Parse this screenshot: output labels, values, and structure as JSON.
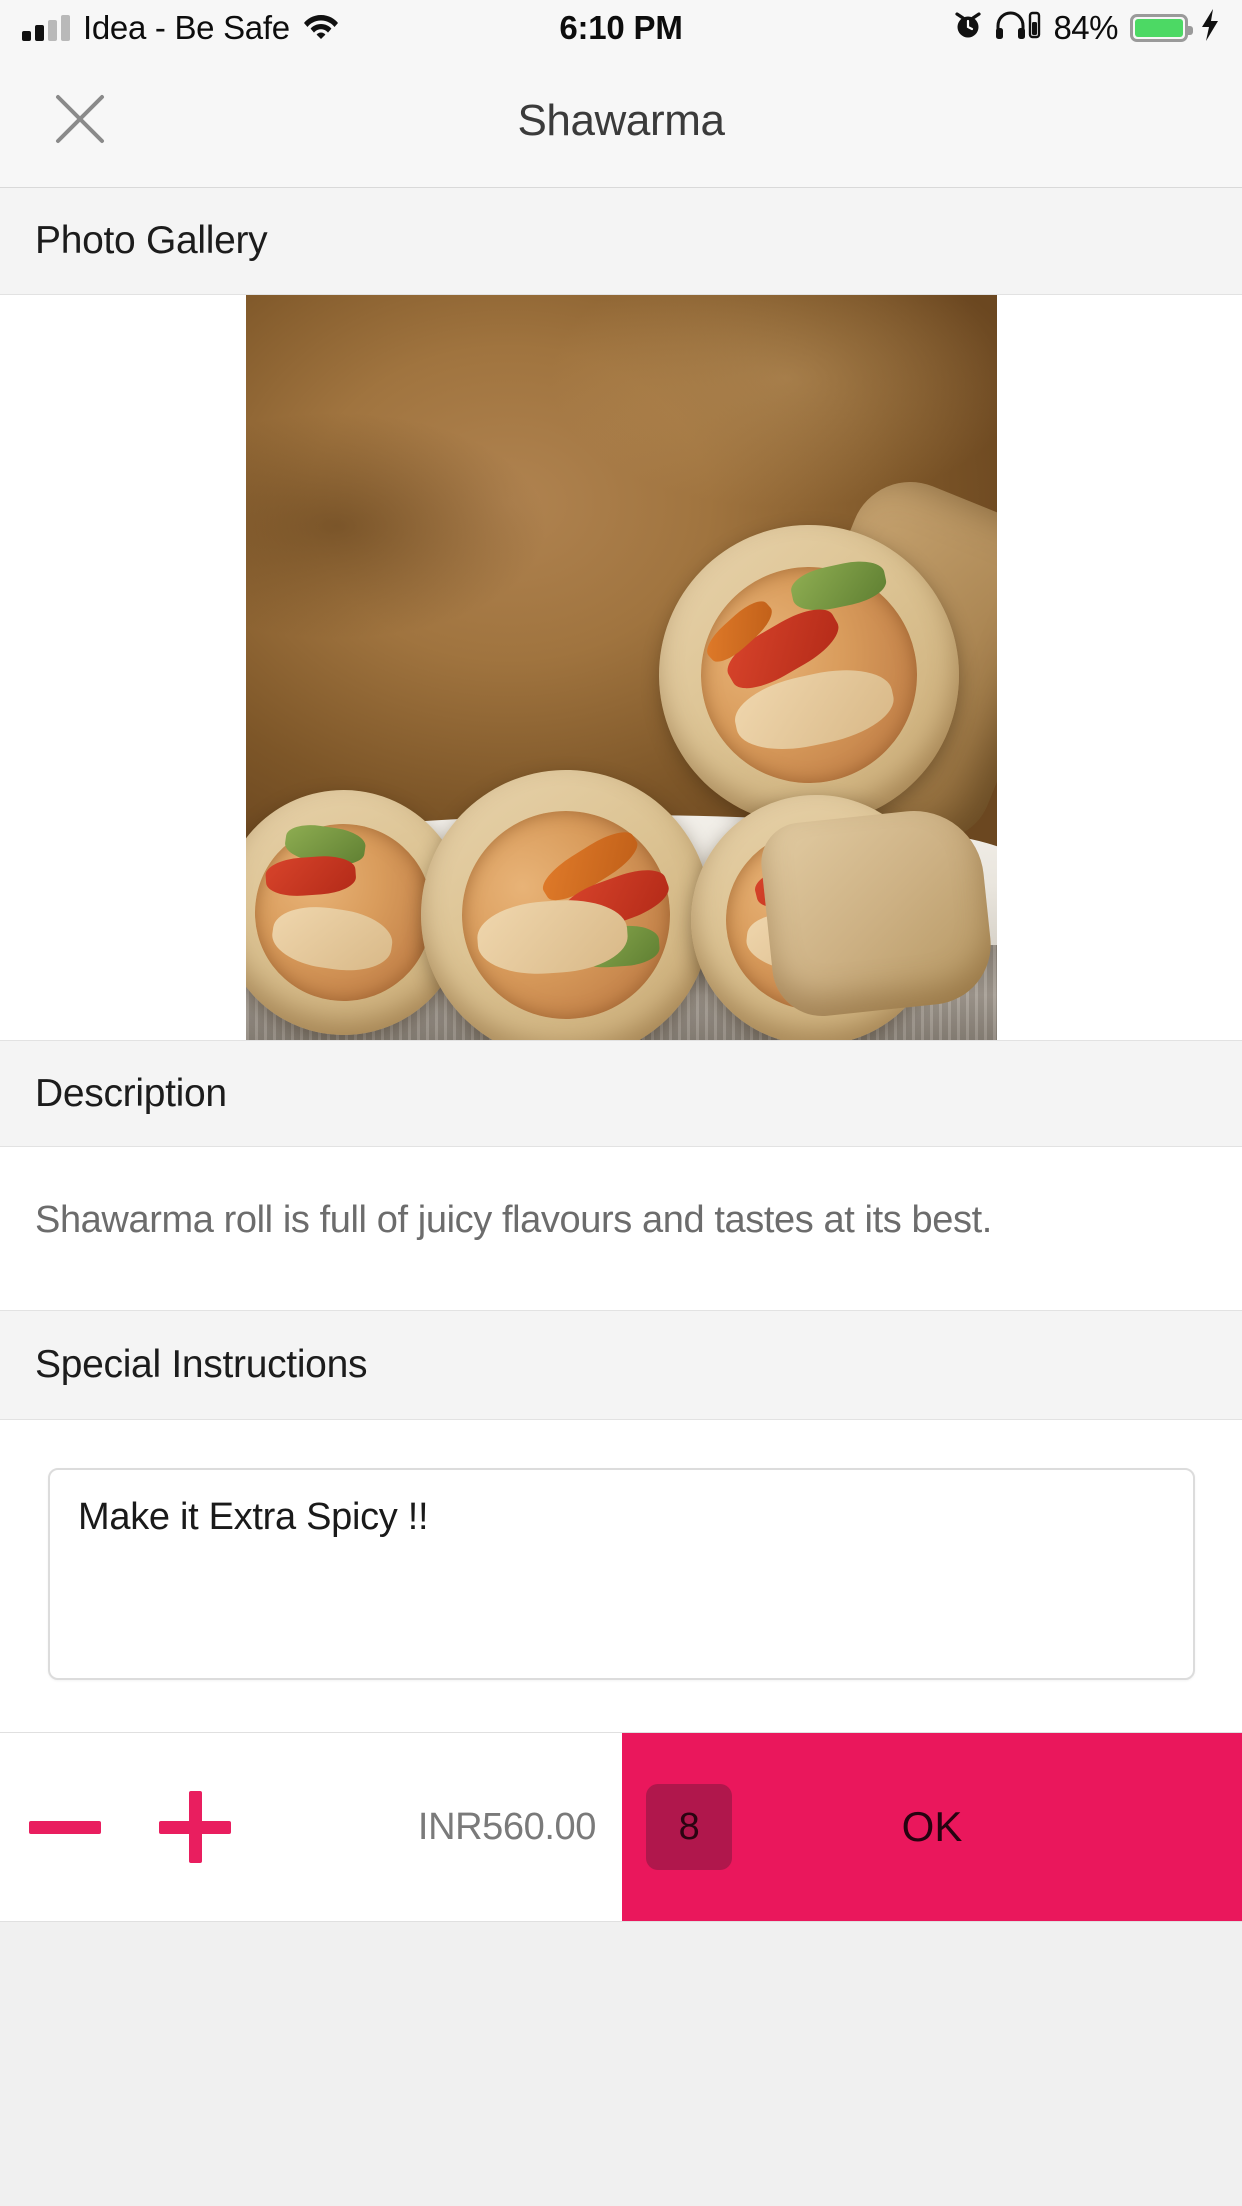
{
  "status_bar": {
    "carrier": "Idea - Be Safe",
    "time": "6:10 PM",
    "battery_percent": "84%",
    "icons": [
      "signal-bars-icon",
      "wifi-icon",
      "alarm-clock-icon",
      "headphones-icon",
      "battery-icon",
      "charging-bolt-icon"
    ]
  },
  "nav": {
    "title": "Shawarma",
    "close_icon": "close-icon"
  },
  "sections": {
    "gallery_title": "Photo Gallery",
    "description_title": "Description",
    "description_text": "Shawarma roll is full of juicy flavours and tastes at its best.",
    "instructions_title": "Special Instructions"
  },
  "gallery": {
    "photo_alt": "Shawarma rolls on a white striped cloth over a wooden table"
  },
  "instructions": {
    "value": "Make it Extra Spicy !!",
    "placeholder": "Special Instructions"
  },
  "action_bar": {
    "decrement_icon": "minus-icon",
    "increment_icon": "plus-icon",
    "price": "INR560.00",
    "quantity": "8",
    "confirm_label": "OK"
  },
  "colors": {
    "accent_pink": "#ea175c",
    "badge_pink": "#b0174c",
    "battery_green": "#4cd964",
    "section_bg": "#f4f4f4"
  }
}
